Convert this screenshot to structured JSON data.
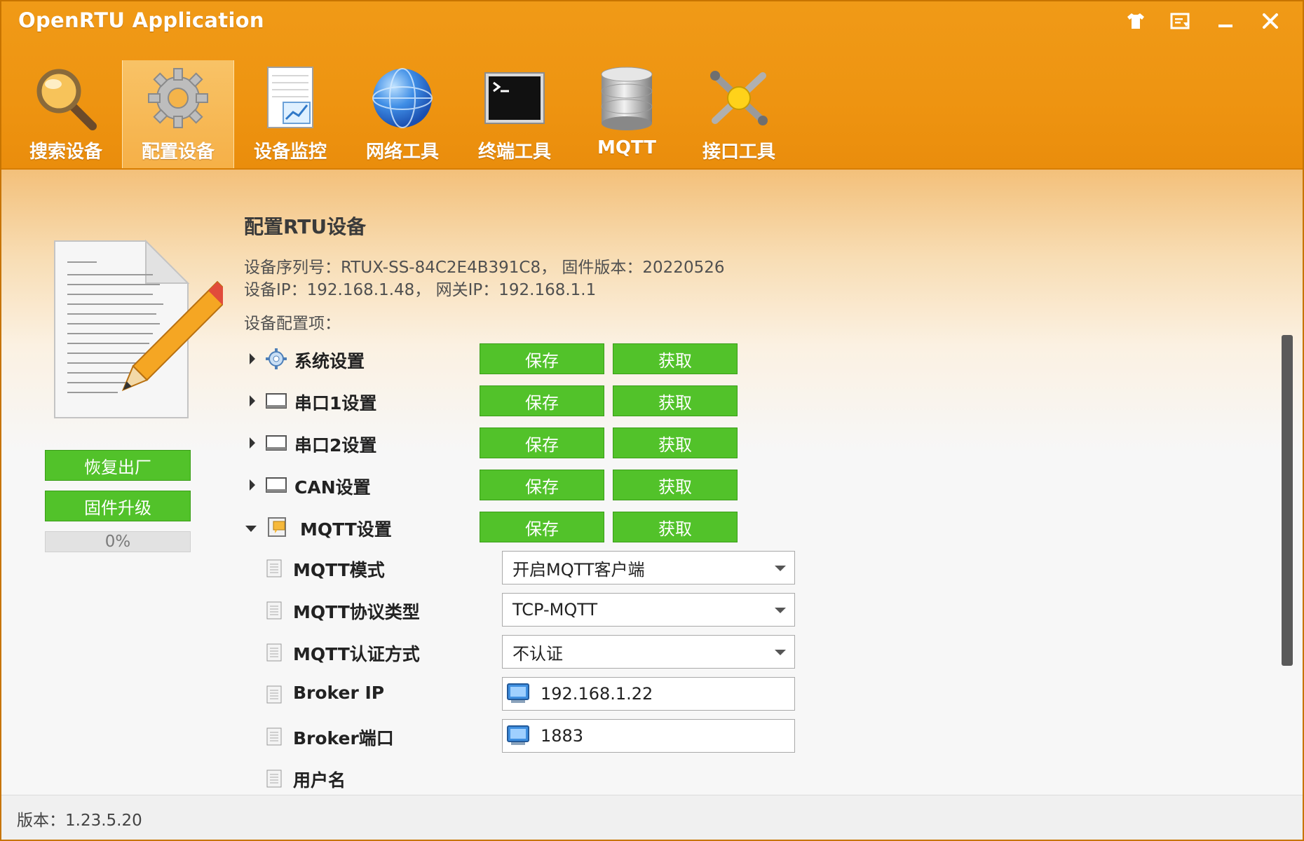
{
  "app": {
    "title": "OpenRTU Application"
  },
  "window_buttons": [
    {
      "name": "skin-icon"
    },
    {
      "name": "menu-icon"
    },
    {
      "name": "minimize-icon"
    },
    {
      "name": "close-icon"
    }
  ],
  "toolbar": {
    "items": [
      {
        "label": "搜索设备",
        "icon": "magnifier-icon",
        "active": false
      },
      {
        "label": "配置设备",
        "icon": "gear-icon",
        "active": true
      },
      {
        "label": "设备监控",
        "icon": "monitor-chart-icon",
        "active": false
      },
      {
        "label": "网络工具",
        "icon": "globe-icon",
        "active": false
      },
      {
        "label": "终端工具",
        "icon": "terminal-icon",
        "active": false
      },
      {
        "label": "MQTT",
        "icon": "database-icon",
        "active": false
      },
      {
        "label": "接口工具",
        "icon": "tools-icon",
        "active": false
      }
    ]
  },
  "left": {
    "restore_label": "恢复出厂",
    "upgrade_label": "固件升级",
    "progress": {
      "text": "0%",
      "value": 0
    }
  },
  "main": {
    "heading": "配置RTU设备",
    "info_line1": "设备序列号：RTUX-SS-84C2E4B391C8， 固件版本：20220526",
    "info_line2": "设备IP：192.168.1.48， 网关IP：192.168.1.1",
    "items_label": "设备配置项：",
    "save_label": "保存",
    "get_label": "获取",
    "sections": [
      {
        "label": "系统设置",
        "icon": "gear-icon",
        "expanded": false
      },
      {
        "label": "串口1设置",
        "icon": "window-icon",
        "expanded": false
      },
      {
        "label": "串口2设置",
        "icon": "window-icon",
        "expanded": false
      },
      {
        "label": "CAN设置",
        "icon": "window-icon",
        "expanded": false
      },
      {
        "label": "MQTT设置",
        "icon": "notes-icon",
        "expanded": true
      }
    ],
    "mqtt_props": [
      {
        "label": "MQTT模式",
        "type": "select",
        "value": "开启MQTT客户端"
      },
      {
        "label": "MQTT协议类型",
        "type": "select",
        "value": "TCP-MQTT"
      },
      {
        "label": "MQTT认证方式",
        "type": "select",
        "value": "不认证"
      },
      {
        "label": "Broker IP",
        "type": "text",
        "value": "192.168.1.22"
      },
      {
        "label": "Broker端口",
        "type": "text",
        "value": "1883"
      },
      {
        "label": "用户名",
        "type": "none",
        "value": ""
      }
    ]
  },
  "status": {
    "version": "版本：1.23.5.20"
  },
  "colors": {
    "header": "#ee9411",
    "button_green": "#52c22a",
    "button_border": "#3a9d18"
  }
}
